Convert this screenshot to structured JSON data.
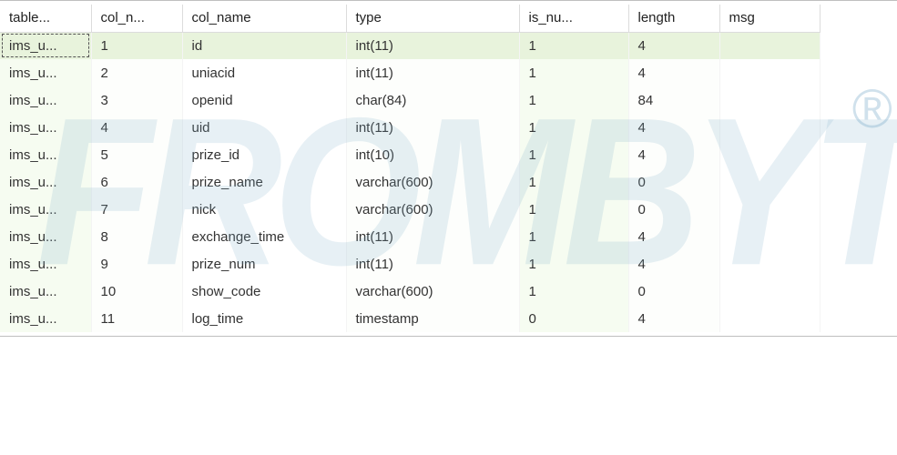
{
  "columns": [
    {
      "key": "table_name",
      "label": "table...",
      "cls": "col-table"
    },
    {
      "key": "col_n",
      "label": "col_n...",
      "cls": "col-coln"
    },
    {
      "key": "col_name",
      "label": "col_name",
      "cls": "col-colname"
    },
    {
      "key": "type",
      "label": "type",
      "cls": "col-type"
    },
    {
      "key": "is_nu",
      "label": "is_nu...",
      "cls": "col-isnu"
    },
    {
      "key": "length",
      "label": "length",
      "cls": "col-length"
    },
    {
      "key": "msg",
      "label": "msg",
      "cls": "col-msg"
    }
  ],
  "rows": [
    {
      "table_name": "ims_u...",
      "col_n": "1",
      "col_name": "id",
      "type": "int(11)",
      "is_nu": "1",
      "length": "4",
      "msg": "",
      "selected": true
    },
    {
      "table_name": "ims_u...",
      "col_n": "2",
      "col_name": "uniacid",
      "type": "int(11)",
      "is_nu": "1",
      "length": "4",
      "msg": ""
    },
    {
      "table_name": "ims_u...",
      "col_n": "3",
      "col_name": "openid",
      "type": "char(84)",
      "is_nu": "1",
      "length": "84",
      "msg": ""
    },
    {
      "table_name": "ims_u...",
      "col_n": "4",
      "col_name": "uid",
      "type": "int(11)",
      "is_nu": "1",
      "length": "4",
      "msg": ""
    },
    {
      "table_name": "ims_u...",
      "col_n": "5",
      "col_name": "prize_id",
      "type": "int(10)",
      "is_nu": "1",
      "length": "4",
      "msg": ""
    },
    {
      "table_name": "ims_u...",
      "col_n": "6",
      "col_name": "prize_name",
      "type": "varchar(600)",
      "is_nu": "1",
      "length": "0",
      "msg": ""
    },
    {
      "table_name": "ims_u...",
      "col_n": "7",
      "col_name": "nick",
      "type": "varchar(600)",
      "is_nu": "1",
      "length": "0",
      "msg": ""
    },
    {
      "table_name": "ims_u...",
      "col_n": "8",
      "col_name": "exchange_time",
      "type": "int(11)",
      "is_nu": "1",
      "length": "4",
      "msg": ""
    },
    {
      "table_name": "ims_u...",
      "col_n": "9",
      "col_name": "prize_num",
      "type": "int(11)",
      "is_nu": "1",
      "length": "4",
      "msg": ""
    },
    {
      "table_name": "ims_u...",
      "col_n": "10",
      "col_name": "show_code",
      "type": "varchar(600)",
      "is_nu": "1",
      "length": "0",
      "msg": ""
    },
    {
      "table_name": "ims_u...",
      "col_n": "11",
      "col_name": "log_time",
      "type": "timestamp",
      "is_nu": "0",
      "length": "4",
      "msg": ""
    }
  ],
  "watermark": "FROMBYTE",
  "watermark_symbol": "®"
}
